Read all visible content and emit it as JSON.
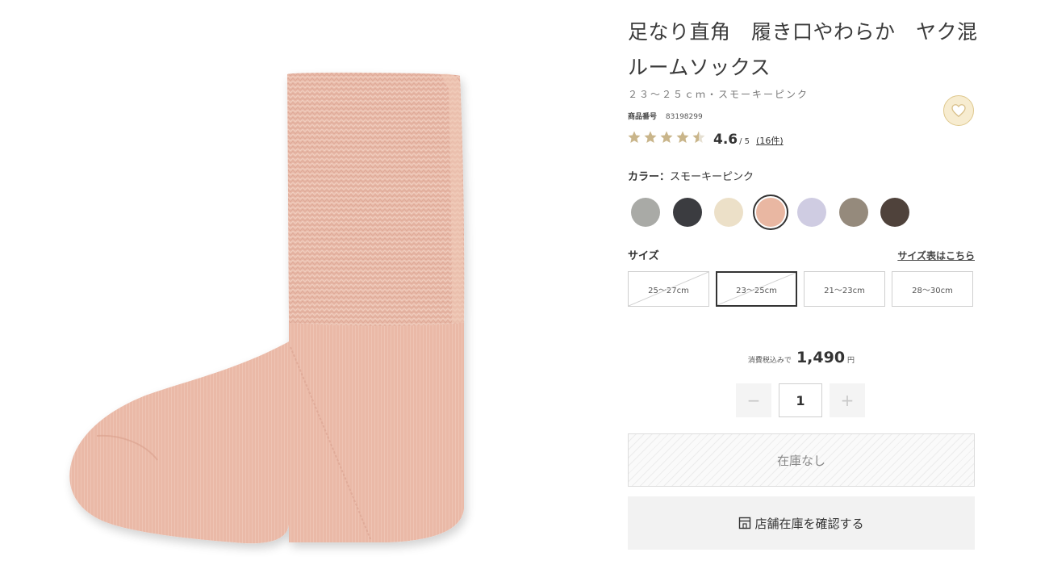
{
  "product": {
    "title_line1": "足なり直角　履き口やわらか　ヤク混",
    "title_line2": "ルームソックス",
    "variant": "２３～２５ｃｍ・スモーキーピンク",
    "sku_label": "商品番号",
    "sku_value": "83198299",
    "rating": {
      "stars": 4.5,
      "stars_display": "★★★★★",
      "score": "4.6",
      "max": "/ 5",
      "reviews": "(16件)"
    },
    "favorite_icon": "heart-icon"
  },
  "color": {
    "label": "カラー：",
    "value": "スモーキーピンク",
    "swatches": [
      {
        "color": "#a9aaa6",
        "selected": false
      },
      {
        "color": "#3b3c40",
        "selected": false
      },
      {
        "color": "#ece0c8",
        "selected": false
      },
      {
        "color": "#e9b7a2",
        "selected": true
      },
      {
        "color": "#cfcce2",
        "selected": false
      },
      {
        "color": "#958a7c",
        "selected": false
      },
      {
        "color": "#4f423b",
        "selected": false
      }
    ]
  },
  "size": {
    "label": "サイズ",
    "chart_link": "サイズ表はこちら",
    "options": [
      {
        "label": "25～27cm",
        "selected": false,
        "unavailable": true
      },
      {
        "label": "23～25cm",
        "selected": true,
        "unavailable": true
      },
      {
        "label": "21～23cm",
        "selected": false,
        "unavailable": false
      },
      {
        "label": "28～30cm",
        "selected": false,
        "unavailable": false
      }
    ]
  },
  "price": {
    "tax_note": "消費税込みで",
    "amount": "1,490",
    "currency": "円"
  },
  "quantity": {
    "minus": "−",
    "value": "1",
    "plus": "+"
  },
  "buttons": {
    "sold_out": "在庫なし",
    "store_check": "店舗在庫を確認する",
    "store_icon": "store-icon"
  },
  "colors": {
    "sock": "#e9bcab",
    "star": "#c9b58a",
    "fav_bg": "#f7ecd0"
  }
}
